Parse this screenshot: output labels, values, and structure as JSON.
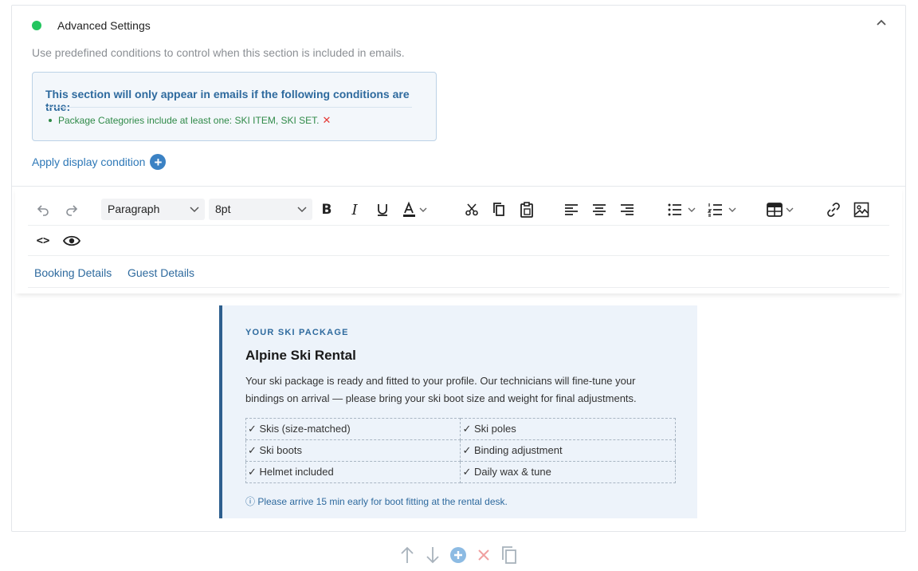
{
  "section": {
    "title": "Advanced Settings",
    "status_color": "#22c55e",
    "description": "Use predefined conditions to control when this section is included in emails."
  },
  "conditions": {
    "heading": "This section will only appear in emails if the following conditions are true:",
    "items": [
      {
        "text": "Package Categories include at least one: SKI ITEM, SKI SET.",
        "remove_glyph": "✕"
      }
    ],
    "apply_label": "Apply display condition"
  },
  "toolbar": {
    "block_format": "Paragraph",
    "font_size": "8pt",
    "icons": [
      "undo-icon",
      "redo-icon",
      "bold-icon",
      "italic-icon",
      "underline-icon",
      "text-color-icon",
      "cut-icon",
      "copy-icon",
      "paste-icon",
      "align-left-icon",
      "align-center-icon",
      "align-right-icon",
      "bullet-list-icon",
      "numbered-list-icon",
      "table-icon",
      "link-icon",
      "image-icon",
      "source-code-icon",
      "preview-icon"
    ],
    "bold_label": "B",
    "italic_label": "I",
    "underline_label": "U",
    "color_label": "A",
    "code_label": "<>"
  },
  "tabs": [
    "Booking Details",
    "Guest Details"
  ],
  "email": {
    "eyebrow": "YOUR SKI PACKAGE",
    "title": "Alpine Ski Rental",
    "body": "Your ski package is ready and fitted to your profile. Our technicians will fine-tune your bindings on arrival — please bring your ski boot size and weight for final adjustments.",
    "items": [
      [
        "✓ Skis (size-matched)",
        "✓ Ski poles"
      ],
      [
        "✓ Ski boots",
        "✓ Binding adjustment"
      ],
      [
        "✓ Helmet included",
        "✓ Daily wax & tune"
      ]
    ],
    "note": "ⓘ  Please arrive 15 min early for boot fitting at the rental desk.",
    "accent_color": "#2e5f8e"
  },
  "footer_actions": [
    "move-up-icon",
    "move-down-icon",
    "add-icon",
    "delete-icon",
    "duplicate-icon"
  ]
}
